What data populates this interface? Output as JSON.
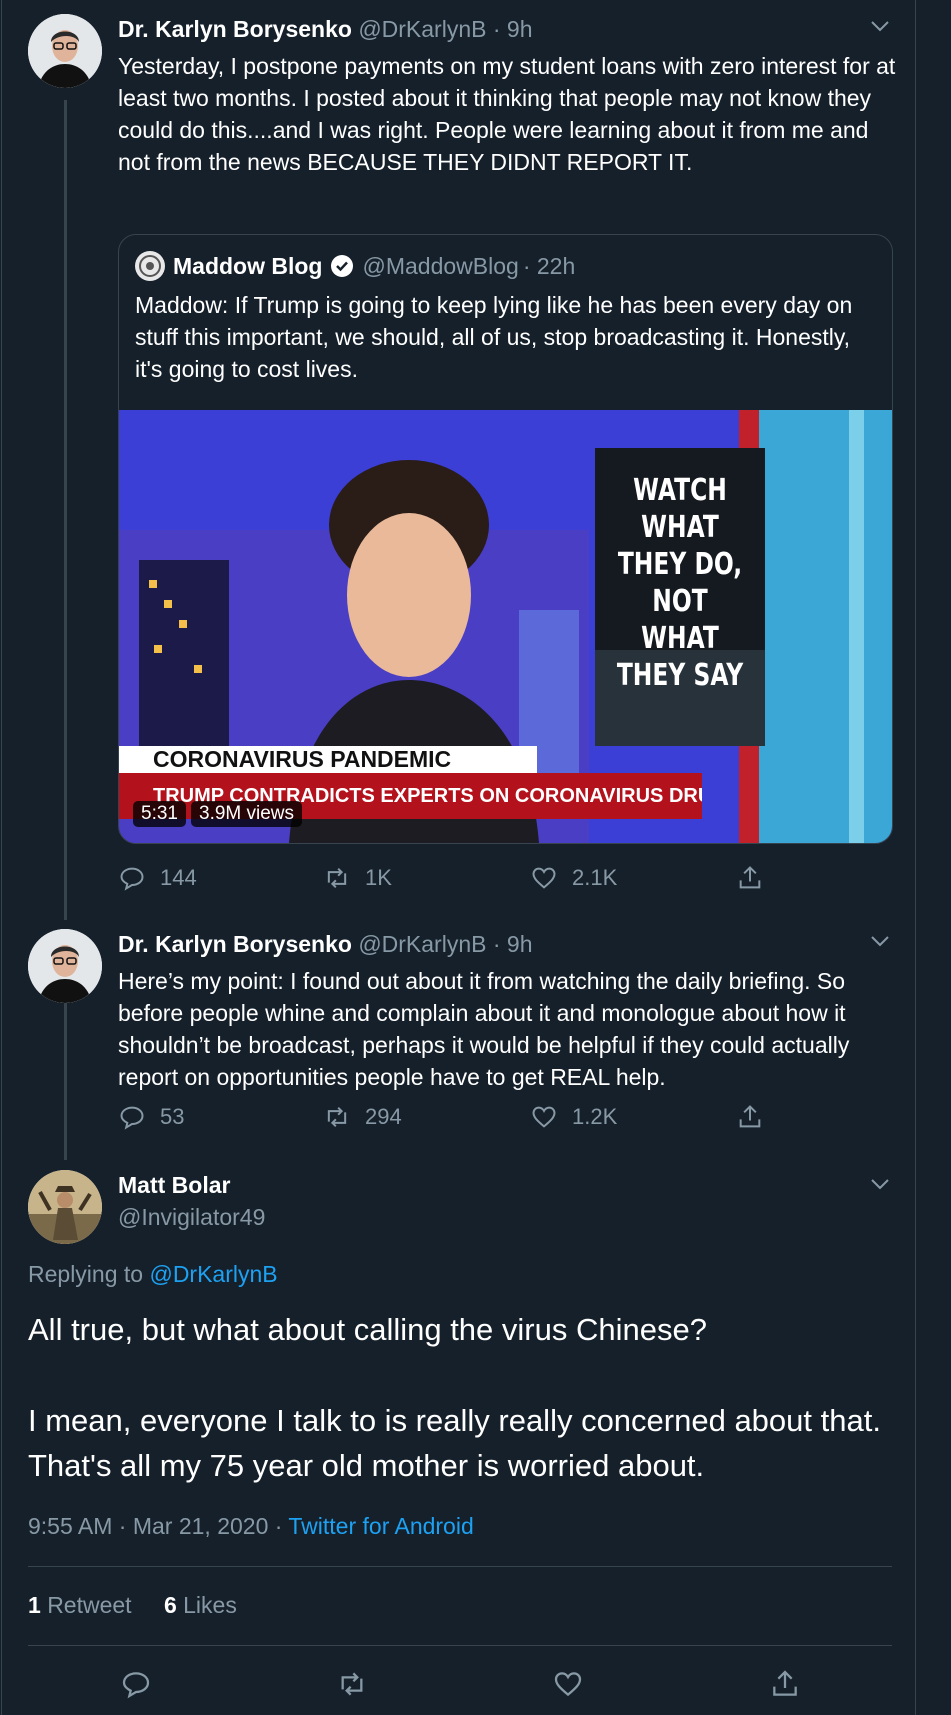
{
  "tweets": [
    {
      "name": "Dr. Karlyn Borysenko",
      "handle": "@DrKarlynB",
      "time": "· 9h",
      "text": "Yesterday, I postpone payments on my student loans with zero interest for at least two months. I posted about it thinking that people may not know they could do this....and I was right. People were learning about it from me and not from the news BECAUSE THEY DIDNT REPORT IT.",
      "quote": {
        "name": "Maddow Blog",
        "handle": "@MaddowBlog",
        "time": "· 22h",
        "text": "Maddow: If Trump is going to keep lying like he has been every day on stuff this important, we should, all of us, stop broadcasting it. Honestly, it's going to cost lives.",
        "media": {
          "sign_line1": "WATCH WHAT",
          "sign_line2": "THEY DO, NOT",
          "sign_line3": "WHAT THEY SAY",
          "banner_top": "CORONAVIRUS PANDEMIC",
          "banner_bottom": "TRUMP CONTRADICTS EXPERTS ON CORONAVIRUS DRUG",
          "duration": "5:31",
          "views": "3.9M views"
        }
      },
      "replies": "144",
      "retweets": "1K",
      "likes": "2.1K"
    },
    {
      "name": "Dr. Karlyn Borysenko",
      "handle": "@DrKarlynB",
      "time": "· 9h",
      "text": "Here’s my point: I found out about it from watching the daily briefing. So before people whine and complain about it and monologue about how it shouldn’t be broadcast, perhaps it would be helpful if they could actually report on opportunities people have to get REAL help.",
      "replies": "53",
      "retweets": "294",
      "likes": "1.2K"
    }
  ],
  "main": {
    "name": "Matt Bolar",
    "handle": "@Invigilator49",
    "replying_prefix": "Replying to",
    "replying_handle": "@DrKarlynB",
    "text_p1": "All true, but what about calling the virus Chinese?",
    "text_p2": "I mean, everyone I talk to is really really concerned about that. That's all my 75 year old mother is worried about.",
    "timestamp": "9:55 AM · Mar 21, 2020 ·",
    "source": "Twitter for Android",
    "retweet_count": "1",
    "retweet_label": "Retweet",
    "like_count": "6",
    "like_label": "Likes"
  },
  "colors": {
    "background": "#15202b",
    "muted": "#8899a6",
    "link": "#1da1f2",
    "border": "#38444d"
  },
  "icons": [
    "reply-icon",
    "retweet-icon",
    "like-icon",
    "share-icon",
    "chevron-down-icon",
    "verified-badge-icon"
  ]
}
